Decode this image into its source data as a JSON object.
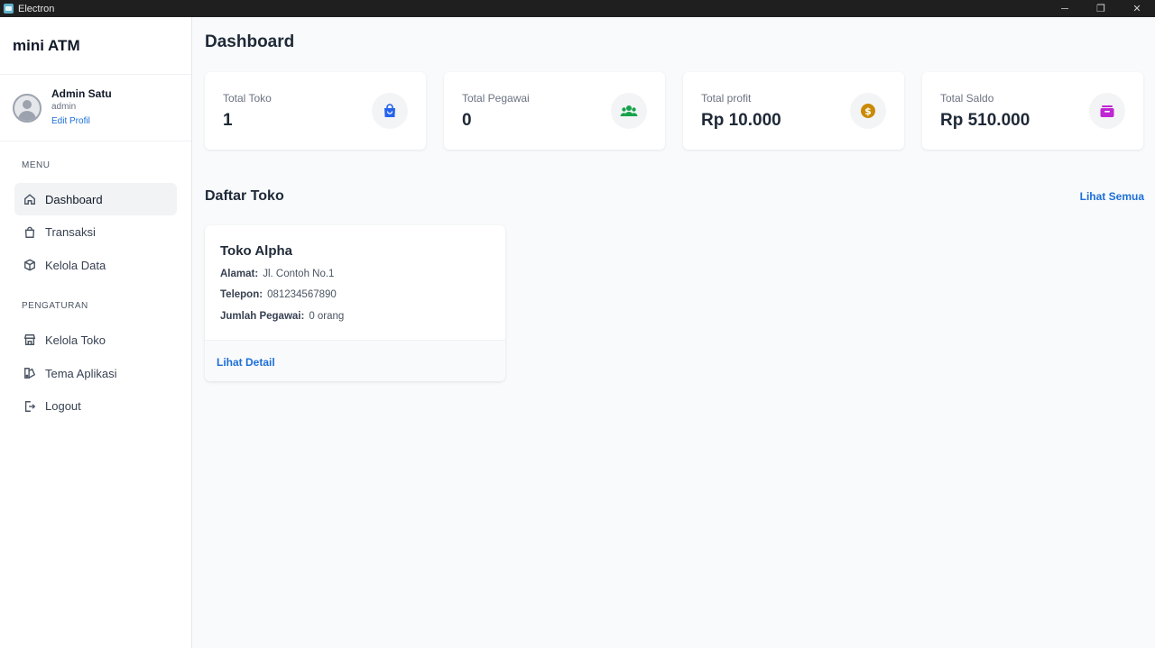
{
  "window": {
    "title": "Electron",
    "minimize": "─",
    "restore": "❐",
    "close": "✕"
  },
  "sidebar": {
    "brand": "mini ATM",
    "profile": {
      "name": "Admin Satu",
      "role": "admin",
      "edit_label": "Edit Profil"
    },
    "menu_label": "MENU",
    "menu_items": [
      {
        "label": "Dashboard",
        "icon": "home-icon",
        "active": true
      },
      {
        "label": "Transaksi",
        "icon": "shopping-bag-icon"
      },
      {
        "label": "Kelola Data",
        "icon": "box-icon"
      }
    ],
    "settings_label": "PENGATURAN",
    "settings_items": [
      {
        "label": "Kelola Toko",
        "icon": "store-icon"
      },
      {
        "label": "Tema Aplikasi",
        "icon": "palette-icon"
      },
      {
        "label": "Logout",
        "icon": "logout-icon"
      }
    ]
  },
  "main": {
    "title": "Dashboard",
    "stats": [
      {
        "label": "Total Toko",
        "value": "1",
        "icon": "shopping-bag-icon",
        "color": "#2563eb"
      },
      {
        "label": "Total Pegawai",
        "value": "0",
        "icon": "users-icon",
        "color": "#16a34a"
      },
      {
        "label": "Total profit",
        "value": "Rp 10.000",
        "icon": "dollar-coin-icon",
        "color": "#ca8a04"
      },
      {
        "label": "Total Saldo",
        "value": "Rp 510.000",
        "icon": "wallet-icon",
        "color": "#c026d3"
      }
    ],
    "section_title": "Daftar Toko",
    "see_all": "Lihat Semua",
    "store": {
      "name": "Toko Alpha",
      "address_label": "Alamat:",
      "address": "Jl. Contoh No.1",
      "phone_label": "Telepon:",
      "phone": "081234567890",
      "employees_label": "Jumlah Pegawai:",
      "employees": "0 orang",
      "detail_link": "Lihat Detail"
    }
  }
}
